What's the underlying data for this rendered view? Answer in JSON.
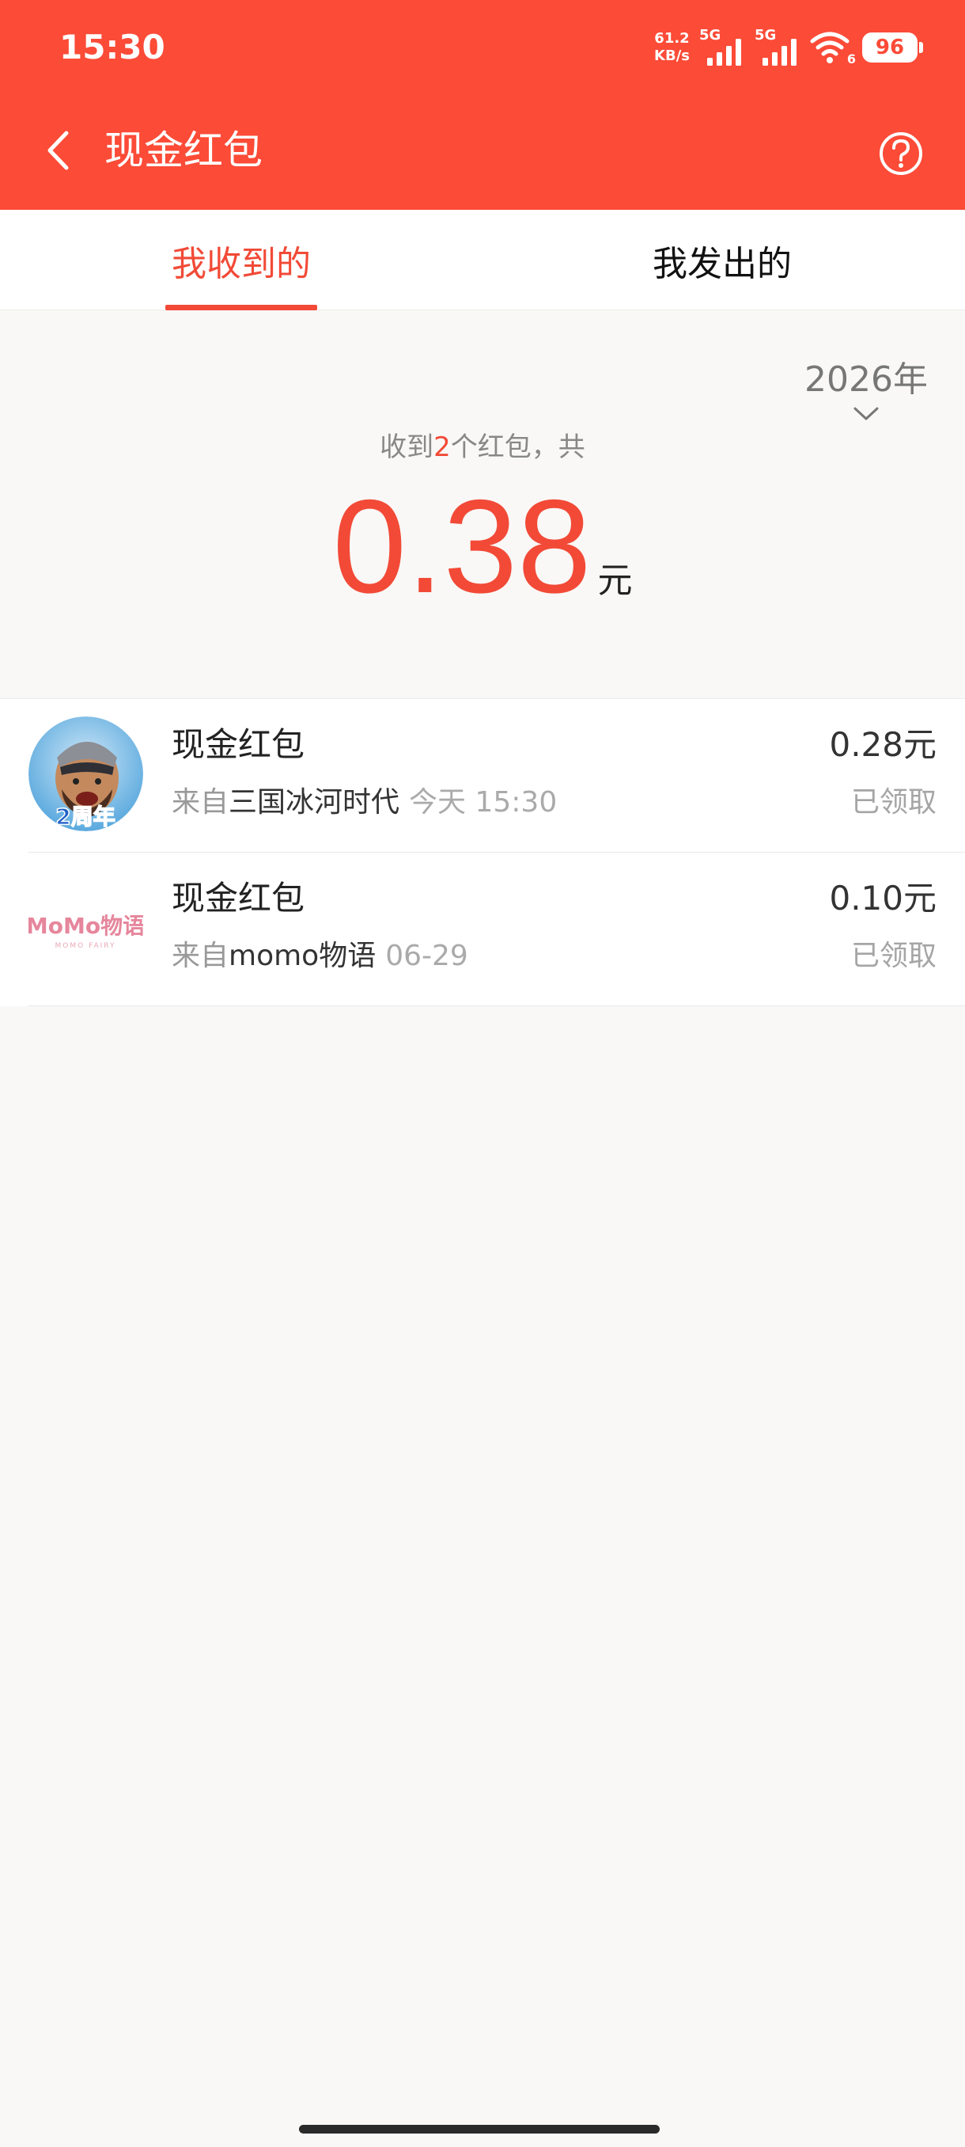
{
  "status_bar": {
    "time": "15:30",
    "net_speed_value": "61.2",
    "net_speed_unit": "KB/s",
    "sim1_tag": "5G",
    "sim2_tag": "5G",
    "wifi_tag": "6",
    "battery": "96"
  },
  "header": {
    "title": "现金红包",
    "back_icon": "chevron-left-icon",
    "help_icon": "question-circle-icon"
  },
  "tabs": [
    {
      "label": "我收到的",
      "active": true
    },
    {
      "label": "我发出的",
      "active": false
    }
  ],
  "summary": {
    "year": "2026年",
    "prefix": "收到",
    "count": "2",
    "suffix": "个红包，共",
    "total": "0.38",
    "unit": "元"
  },
  "list": [
    {
      "title": "现金红包",
      "from_prefix": "来自",
      "source": "三国冰河时代",
      "time": "今天 15:30",
      "amount": "0.28元",
      "status": "已领取",
      "avatar_badge": "2周年"
    },
    {
      "title": "现金红包",
      "from_prefix": "来自",
      "source": "momo物语",
      "time": "06-29",
      "amount": "0.10元",
      "status": "已领取",
      "avatar_logo": "MoMo物语",
      "avatar_logo_sub": "MOMO FAIRY"
    }
  ],
  "colors": {
    "header_bg": "#fc4b37",
    "accent_red": "#f24a37",
    "page_bg": "#f9f8f6"
  }
}
